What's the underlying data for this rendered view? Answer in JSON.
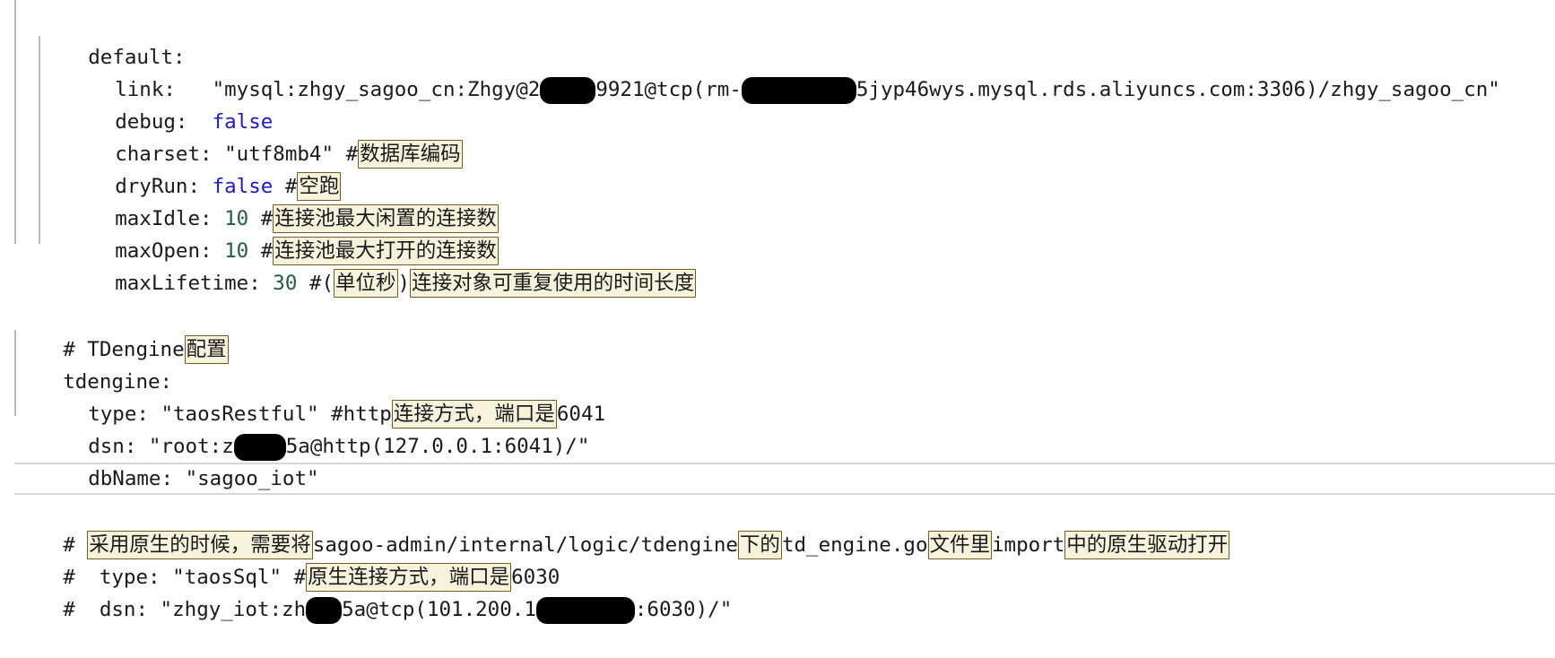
{
  "editor": {
    "lines": [
      {
        "key": "default:",
        "value": "",
        "comment": ""
      },
      {
        "key": "link:",
        "value": "\"mysql:zhgy_sagoo_cn:Zhgy@2",
        "value2": "9921@tcp(rm-",
        "value3": "5jyp46wys.mysql.rds.aliyuncs.com:3306)/zhgy_sagoo_cn\"",
        "comment": ""
      },
      {
        "key": "debug:",
        "value": "false",
        "comment": ""
      },
      {
        "key": "charset:",
        "value": "\"utf8mb4\"",
        "comment_prefix": "#",
        "comment": "数据库编码"
      },
      {
        "key": "dryRun:",
        "value": "false",
        "comment_prefix": "#",
        "comment": "空跑"
      },
      {
        "key": "maxIdle:",
        "value": "10",
        "comment_prefix": "#",
        "comment": "连接池最大闲置的连接数"
      },
      {
        "key": "maxOpen:",
        "value": "10",
        "comment_prefix": "#",
        "comment": "连接池最大打开的连接数"
      },
      {
        "key": "maxLifetime:",
        "value": "30",
        "comment_prefix": "#(",
        "comment": "单位秒",
        "comment_mid": ")",
        "comment2": "连接对象可重复使用的时间长度"
      },
      {
        "prefix": "# TDengine",
        "comment": "配置"
      },
      {
        "key": "tdengine:"
      },
      {
        "key": "type:",
        "value": "\"taosRestful\"",
        "comment_prefix": "#http",
        "comment": "连接方式，端口是",
        "comment_tail": "6041"
      },
      {
        "key": "dsn:",
        "value": "\"root:z",
        "value2": "5a@http(127.0.0.1:6041)/\""
      },
      {
        "key": "dbName:",
        "value": "\"sagoo_iot\""
      },
      {
        "prefix": "# ",
        "comment": "采用原生的时候，需要将",
        "seg1": "sagoo-admin/internal/logic/tdengine",
        "comment2": "下的",
        "seg2": "td_engine.go",
        "comment3": "文件里",
        "seg3": "import",
        "comment4": "中的原生驱动打开"
      },
      {
        "prefix": "#  type: \"taosSql\" #",
        "comment": "原生连接方式，端口是",
        "tail": "6030"
      },
      {
        "prefix": "#  dsn: \"zhgy_iot:zh",
        "mid": "5a@tcp(101.200.1",
        "tail": ":6030)/\""
      }
    ]
  }
}
